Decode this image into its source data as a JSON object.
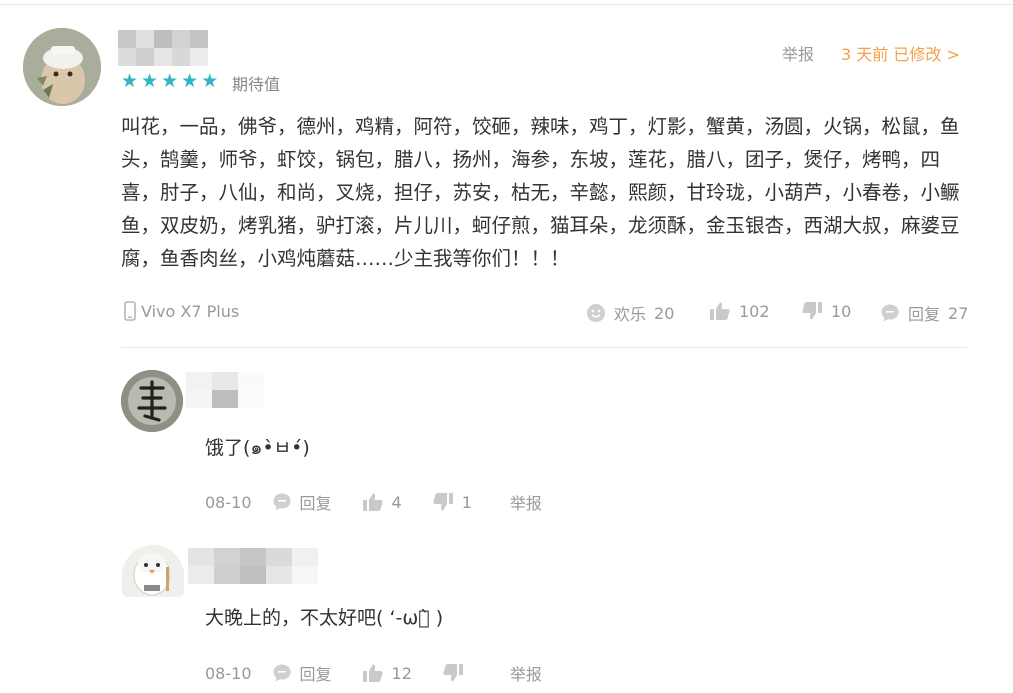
{
  "review": {
    "rating_label": "期待值",
    "stars": 5,
    "report_label": "举报",
    "time_label": "3 天前 已修改 >",
    "text": "叫花，一品，佛爷，德州，鸡精，阿符，饺砸，辣味，鸡丁，灯影，蟹黄，汤圆，火锅，松鼠，鱼头，鹄羹，师爷，虾饺，锅包，腊八，扬州，海参，东坡，莲花，腊八，团子，煲仔，烤鸭，四喜，肘子，八仙，和尚，叉烧，担仔，苏安，枯无，辛懿，熙颜，甘玲珑，小葫芦，小春卷，小鳜鱼，双皮奶，烤乳猪，驴打滚，片儿川，蚵仔煎，猫耳朵，龙须酥，金玉银杏，西湖大叔，麻婆豆腐，鱼香肉丝，小鸡炖蘑菇……少主我等你们！！！",
    "device": "Vivo X7 Plus",
    "fun_label": "欢乐",
    "fun_count": "20",
    "like_count": "102",
    "dislike_count": "10",
    "reply_label": "回复",
    "reply_count": "27"
  },
  "replies": [
    {
      "text": "饿了(๑•̀ㅂ•́)",
      "date": "08-10",
      "reply_label": "回复",
      "like_count": "4",
      "dislike_count": "1",
      "report_label": "举报"
    },
    {
      "text": "大晚上的，不太好吧( ‘-ωก̀ )",
      "date": "08-10",
      "reply_label": "回复",
      "like_count": "12",
      "dislike_count": "",
      "report_label": "举报"
    }
  ],
  "icons": {
    "star": "star-icon",
    "phone": "phone-icon",
    "smile": "smile-icon",
    "thumb_up": "thumb-up-icon",
    "thumb_down": "thumb-down-icon",
    "comment": "comment-icon"
  },
  "colors": {
    "star": "#2fb5c3",
    "time": "#f5a04a",
    "meta": "#999999"
  }
}
